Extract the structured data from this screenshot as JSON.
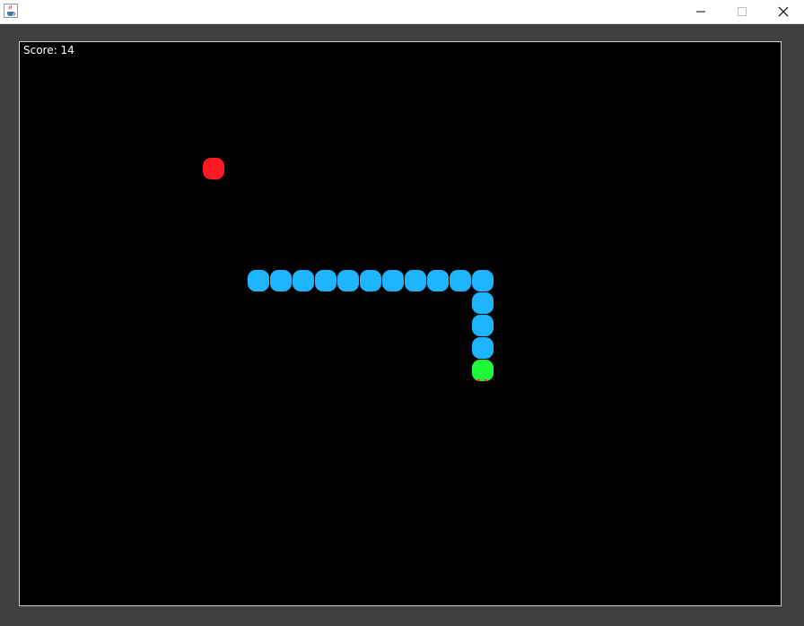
{
  "window": {
    "title": "",
    "icon": "java-cup-icon",
    "controls": [
      "minimize-icon",
      "maximize-icon",
      "close-icon"
    ]
  },
  "game": {
    "score_label": "Score: 14",
    "colors": {
      "background": "#000000",
      "snake_body": "#1fb4ff",
      "snake_head": "#1cfa3a",
      "food": "#ff1a22",
      "text": "#ffffff"
    },
    "snake_length": 15,
    "direction": "down"
  }
}
